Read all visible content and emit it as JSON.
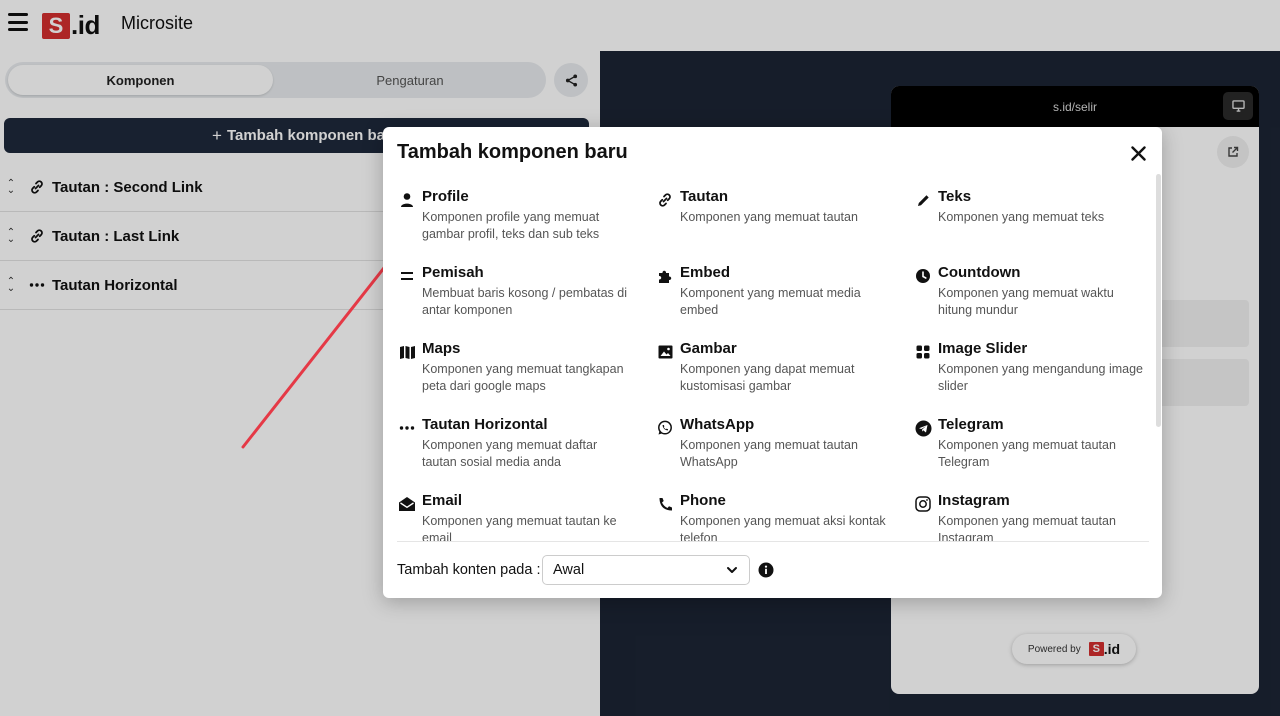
{
  "header": {
    "logo_s": "S",
    "logo_id": ".id",
    "app_title": "Microsite"
  },
  "left": {
    "tabs": [
      {
        "label": "Komponen"
      },
      {
        "label": "Pengaturan"
      }
    ],
    "add_button": {
      "label": "Tambah komponen baru"
    },
    "components": [
      {
        "label": "Tautan : Second Link",
        "icon": "link-icon"
      },
      {
        "label": "Tautan : Last Link",
        "icon": "link-icon"
      },
      {
        "label": "Tautan Horizontal",
        "icon": "dots-icon"
      }
    ]
  },
  "preview": {
    "url": "s.id/selir",
    "powered_by": "Powered by",
    "powered_logo_s": "S",
    "powered_logo_id": ".id"
  },
  "modal": {
    "title": "Tambah komponen baru",
    "items": [
      {
        "title": "Profile",
        "desc": "Komponen profile yang memuat gambar profil, teks dan sub teks",
        "icon": "person-icon"
      },
      {
        "title": "Tautan",
        "desc": "Komponen yang memuat tautan",
        "icon": "link-icon"
      },
      {
        "title": "Teks",
        "desc": "Komponen yang memuat teks",
        "icon": "pencil-icon"
      },
      {
        "title": "Pemisah",
        "desc": "Membuat baris kosong / pembatas di antar komponen",
        "icon": "equals-icon"
      },
      {
        "title": "Embed",
        "desc": "Komponent yang memuat media embed",
        "icon": "puzzle-icon"
      },
      {
        "title": "Countdown",
        "desc": "Komponen yang memuat waktu hitung mundur",
        "icon": "clock-icon"
      },
      {
        "title": "Maps",
        "desc": "Komponen yang memuat tangkapan peta dari google maps",
        "icon": "map-icon"
      },
      {
        "title": "Gambar",
        "desc": "Komponen yang dapat memuat kustomisasi gambar",
        "icon": "image-icon"
      },
      {
        "title": "Image Slider",
        "desc": "Komponen yang mengandung image slider",
        "icon": "grid-icon"
      },
      {
        "title": "Tautan Horizontal",
        "desc": "Komponen yang memuat daftar tautan sosial media anda",
        "icon": "dots-icon"
      },
      {
        "title": "WhatsApp",
        "desc": "Komponen yang memuat tautan WhatsApp",
        "icon": "whatsapp-icon"
      },
      {
        "title": "Telegram",
        "desc": "Komponen yang memuat tautan Telegram",
        "icon": "telegram-icon"
      },
      {
        "title": "Email",
        "desc": "Komponen yang memuat tautan ke email",
        "icon": "envelope-icon"
      },
      {
        "title": "Phone",
        "desc": "Komponen yang memuat aksi kontak telefon",
        "icon": "phone-icon"
      },
      {
        "title": "Instagram",
        "desc": "Komponen yang memuat tautan Instagram",
        "icon": "instagram-icon"
      }
    ],
    "footer": {
      "label": "Tambah konten pada :",
      "select_value": "Awal"
    }
  },
  "colors": {
    "brand_red": "#d32f2f",
    "dark_navy": "#1e293b",
    "annotation_arrow": "#e53946"
  }
}
